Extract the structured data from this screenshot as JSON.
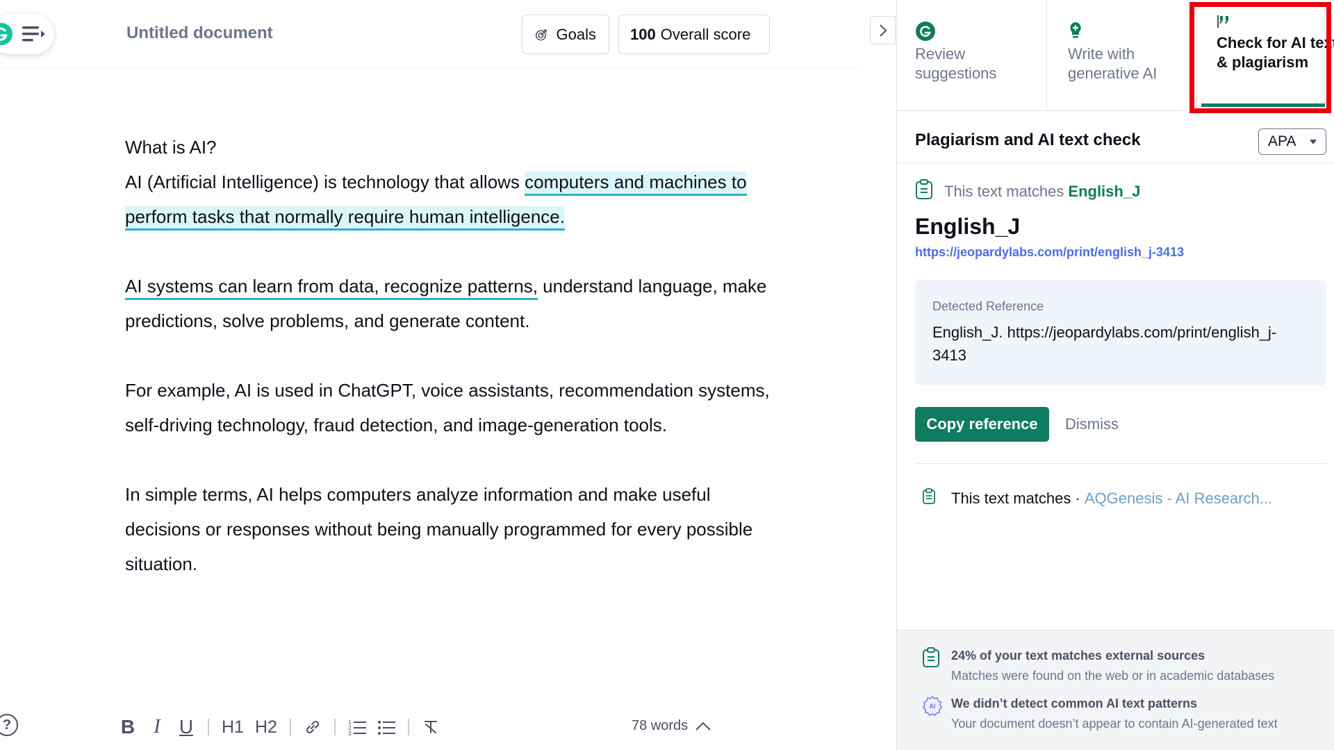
{
  "editor": {
    "doc_title": "Untitled document",
    "goals_label": "Goals",
    "score_value": "100",
    "score_label": "Overall score",
    "paragraphs": {
      "p1_line1": "What is AI?",
      "p1_line2_plain": "AI (Artificial Intelligence) is technology that allows ",
      "p1_line2_highlight": "computers and machines to perform tasks that normally require human intelligence.",
      "p2_underlined": "AI systems can learn from data, recognize patterns,",
      "p2_rest": " understand language, make predictions, solve problems, and generate content.",
      "p3": "For example, AI is used in ChatGPT, voice assistants, recommendation systems, self-driving technology, fraud detection, and image-generation tools.",
      "p4": "In simple terms, AI helps computers analyze information and make useful decisions or responses without being manually programmed for every possible situation."
    },
    "toolbar": {
      "bold": "B",
      "italic": "I",
      "underline": "U",
      "h1": "H1",
      "h2": "H2"
    },
    "word_count": "78 words",
    "help_glyph": "?"
  },
  "sidebar": {
    "tabs": [
      {
        "label": "Review suggestions",
        "icon": "grammarly-g-icon"
      },
      {
        "label": "Write with generative AI",
        "icon": "bulb-icon"
      },
      {
        "label": "Check for AI text & plagiarism",
        "icon": "quote-icon"
      }
    ],
    "panel_title": "Plagiarism and AI text check",
    "citation_style": "APA",
    "match_prefix": "This text matches",
    "match_source": "English_J",
    "source_title": "English_J",
    "source_url": "https://jeopardylabs.com/print/english_j-3413",
    "detected_label": "Detected Reference",
    "detected_text": "English_J. https://jeopardylabs.com/print/english_j-3413",
    "copy_button": "Copy reference",
    "dismiss_button": "Dismiss",
    "second_match_prefix": "This text matches ·",
    "second_match_source": "AQGenesis - AI Research...",
    "footer": {
      "plag_title": "24% of your text matches external sources",
      "plag_desc": "Matches were found on the web or in academic databases",
      "ai_title": "We didn’t detect common AI text patterns",
      "ai_desc": "Your document doesn’t appear to contain AI-generated text"
    }
  },
  "colors": {
    "brand_green": "#0f7b5f",
    "highlight_bg": "#dbf6fa",
    "underline_teal": "#28b3c3",
    "annotation_red": "#e8000b"
  }
}
